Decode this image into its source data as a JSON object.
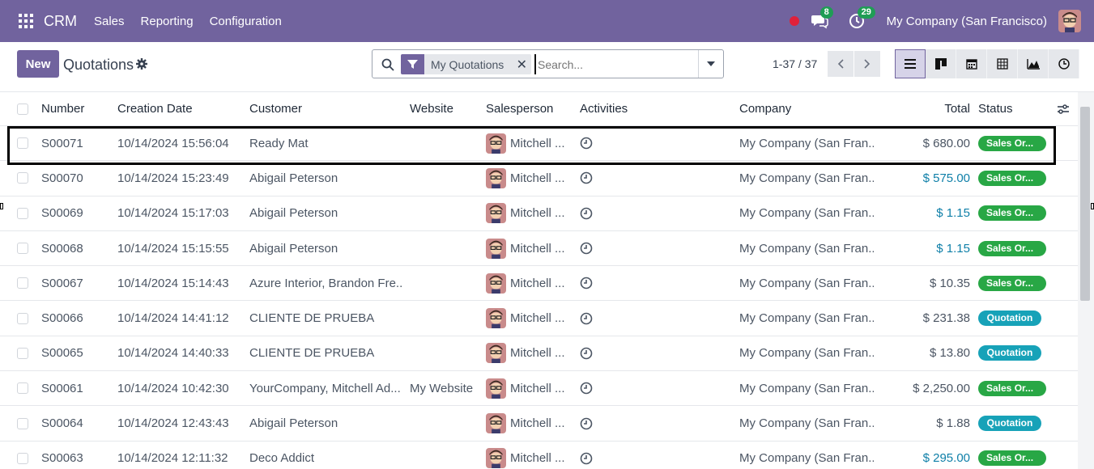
{
  "navbar": {
    "brand": "CRM",
    "menu": [
      "Sales",
      "Reporting",
      "Configuration"
    ],
    "messages_badge": "8",
    "activities_badge": "29",
    "company": "My Company (San Francisco)"
  },
  "control": {
    "new_label": "New",
    "title": "Quotations",
    "facet": "My Quotations",
    "search_placeholder": "Search...",
    "pager": "1-37 / 37"
  },
  "table": {
    "headers": {
      "number": "Number",
      "date": "Creation Date",
      "customer": "Customer",
      "website": "Website",
      "salesperson": "Salesperson",
      "activities": "Activities",
      "company": "Company",
      "total": "Total",
      "status": "Status"
    },
    "rows": [
      {
        "number": "S00071",
        "date": "10/14/2024 15:56:04",
        "customer": "Ready Mat",
        "website": "",
        "salesperson": "Mitchell ...",
        "company": "My Company (San Fran...",
        "total": "$ 680.00",
        "status": "Sales Or...",
        "status_kind": "green",
        "total_link": false
      },
      {
        "number": "S00070",
        "date": "10/14/2024 15:23:49",
        "customer": "Abigail Peterson",
        "website": "",
        "salesperson": "Mitchell ...",
        "company": "My Company (San Fran...",
        "total": "$ 575.00",
        "status": "Sales Or...",
        "status_kind": "green",
        "total_link": true
      },
      {
        "number": "S00069",
        "date": "10/14/2024 15:17:03",
        "customer": "Abigail Peterson",
        "website": "",
        "salesperson": "Mitchell ...",
        "company": "My Company (San Fran...",
        "total": "$ 1.15",
        "status": "Sales Or...",
        "status_kind": "green",
        "total_link": true
      },
      {
        "number": "S00068",
        "date": "10/14/2024 15:15:55",
        "customer": "Abigail Peterson",
        "website": "",
        "salesperson": "Mitchell ...",
        "company": "My Company (San Fran...",
        "total": "$ 1.15",
        "status": "Sales Or...",
        "status_kind": "green",
        "total_link": true
      },
      {
        "number": "S00067",
        "date": "10/14/2024 15:14:43",
        "customer": "Azure Interior, Brandon Fre...",
        "website": "",
        "salesperson": "Mitchell ...",
        "company": "My Company (San Fran...",
        "total": "$ 10.35",
        "status": "Sales Or...",
        "status_kind": "green",
        "total_link": false
      },
      {
        "number": "S00066",
        "date": "10/14/2024 14:41:12",
        "customer": "CLIENTE DE PRUEBA",
        "website": "",
        "salesperson": "Mitchell ...",
        "company": "My Company (San Fran...",
        "total": "$ 231.38",
        "status": "Quotation",
        "status_kind": "teal",
        "total_link": false
      },
      {
        "number": "S00065",
        "date": "10/14/2024 14:40:33",
        "customer": "CLIENTE DE PRUEBA",
        "website": "",
        "salesperson": "Mitchell ...",
        "company": "My Company (San Fran...",
        "total": "$ 13.80",
        "status": "Quotation",
        "status_kind": "teal",
        "total_link": false
      },
      {
        "number": "S00061",
        "date": "10/14/2024 10:42:30",
        "customer": "YourCompany, Mitchell Ad...",
        "website": "My Website",
        "salesperson": "Mitchell ...",
        "company": "My Company (San Fran...",
        "total": "$ 2,250.00",
        "status": "Sales Or...",
        "status_kind": "green",
        "total_link": false
      },
      {
        "number": "S00064",
        "date": "10/14/2024 12:43:43",
        "customer": "Abigail Peterson",
        "website": "",
        "salesperson": "Mitchell ...",
        "company": "My Company (San Fran...",
        "total": "$ 1.88",
        "status": "Quotation",
        "status_kind": "teal",
        "total_link": false
      },
      {
        "number": "S00063",
        "date": "10/14/2024 12:11:32",
        "customer": "Deco Addict",
        "website": "",
        "salesperson": "Mitchell ...",
        "company": "My Company (San Fran...",
        "total": "$ 295.00",
        "status": "Sales Or...",
        "status_kind": "green",
        "total_link": true
      }
    ]
  },
  "colors": {
    "brand": "#71639e",
    "green": "#28a745",
    "teal": "#17a2b8",
    "link": "#0e7fa8"
  }
}
